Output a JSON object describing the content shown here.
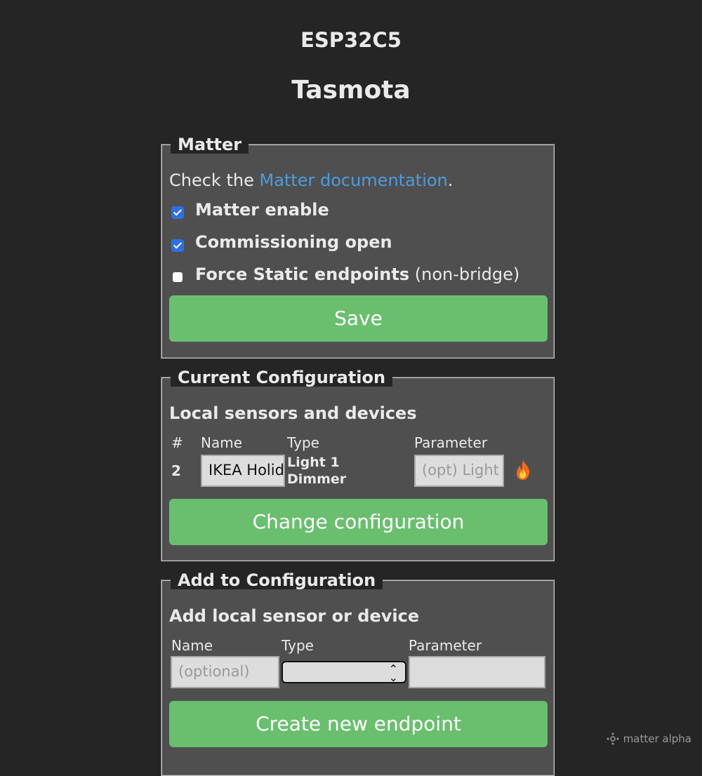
{
  "header": {
    "device": "ESP32C5",
    "title": "Tasmota"
  },
  "matter": {
    "legend": "Matter",
    "doc_prefix": "Check the ",
    "doc_link": "Matter documentation",
    "doc_suffix": ".",
    "enable_label": "Matter enable",
    "enable_checked": true,
    "commissioning_label": "Commissioning open",
    "commissioning_checked": true,
    "static_label": "Force Static endpoints",
    "static_note": "(non-bridge)",
    "static_checked": false,
    "save_label": "Save"
  },
  "current": {
    "legend": "Current Configuration",
    "subtitle": "Local sensors and devices",
    "columns": [
      "#",
      "Name",
      "Type",
      "Parameter"
    ],
    "rows": [
      {
        "index": "2",
        "name": "IKEA Holid",
        "type_line1": "Light 1",
        "type_line2": "Dimmer",
        "parameter_placeholder": "(opt) Light",
        "delete_icon": "fire-icon"
      }
    ],
    "change_label": "Change configuration"
  },
  "add": {
    "legend": "Add to Configuration",
    "subtitle": "Add local sensor or device",
    "name_label": "Name",
    "type_label": "Type",
    "param_label": "Parameter",
    "name_placeholder": "(optional)",
    "type_value": "",
    "param_value": "",
    "create_label": "Create new endpoint"
  },
  "watermark": {
    "icon": "matter-logo-icon",
    "text": "matter alpha"
  },
  "colors": {
    "background": "#252525",
    "panel": "#4f4f4f",
    "button": "#6abf6f",
    "link": "#4d9be0",
    "checkbox": "#2f6fe4"
  }
}
